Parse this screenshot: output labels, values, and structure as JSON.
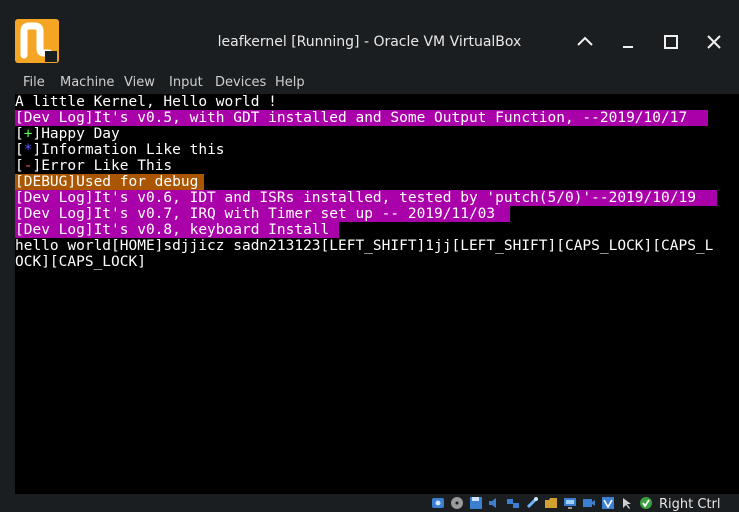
{
  "window": {
    "title": "leafkernel [Running] - Oracle VM VirtualBox",
    "minimize_icon": "chevron-up-icon",
    "restore_icon": "chevron-down-icon",
    "maximize_icon": "square-icon",
    "close_icon": "close-icon"
  },
  "menu": [
    "File",
    "Machine",
    "View",
    "Input",
    "Devices",
    "Help"
  ],
  "console": {
    "lines": [
      "A little Kernel, Hello world !",
      "[Dev Log]It's v0.5, with GDT installed and Some Output Function, --2019/10/17",
      "Happy Day",
      "Information Like this",
      "Error Like This",
      "[DEBUG]Used for debug",
      "[Dev Log]It's v0.6, IDT and ISRs installed, tested by 'putch(5/0)'--2019/10/19",
      "[Dev Log]It's v0.7, IRQ with Timer set up -- 2019/11/03",
      "[Dev Log]It's v0.8, keyboard Install",
      "hello world[HOME]sdjjicz sadn213123[LEFT_SHIFT]1jj[LEFT_SHIFT][CAPS_LOCK][CAPS_L",
      "OCK][CAPS_LOCK]"
    ],
    "markers": {
      "plus": "+",
      "info": "*",
      "err": "-"
    },
    "colors": {
      "magenta_highlight": "#aa00aa",
      "orange_highlight": "#aa5500"
    }
  },
  "statusbar": {
    "host_key": "Right Ctrl"
  }
}
